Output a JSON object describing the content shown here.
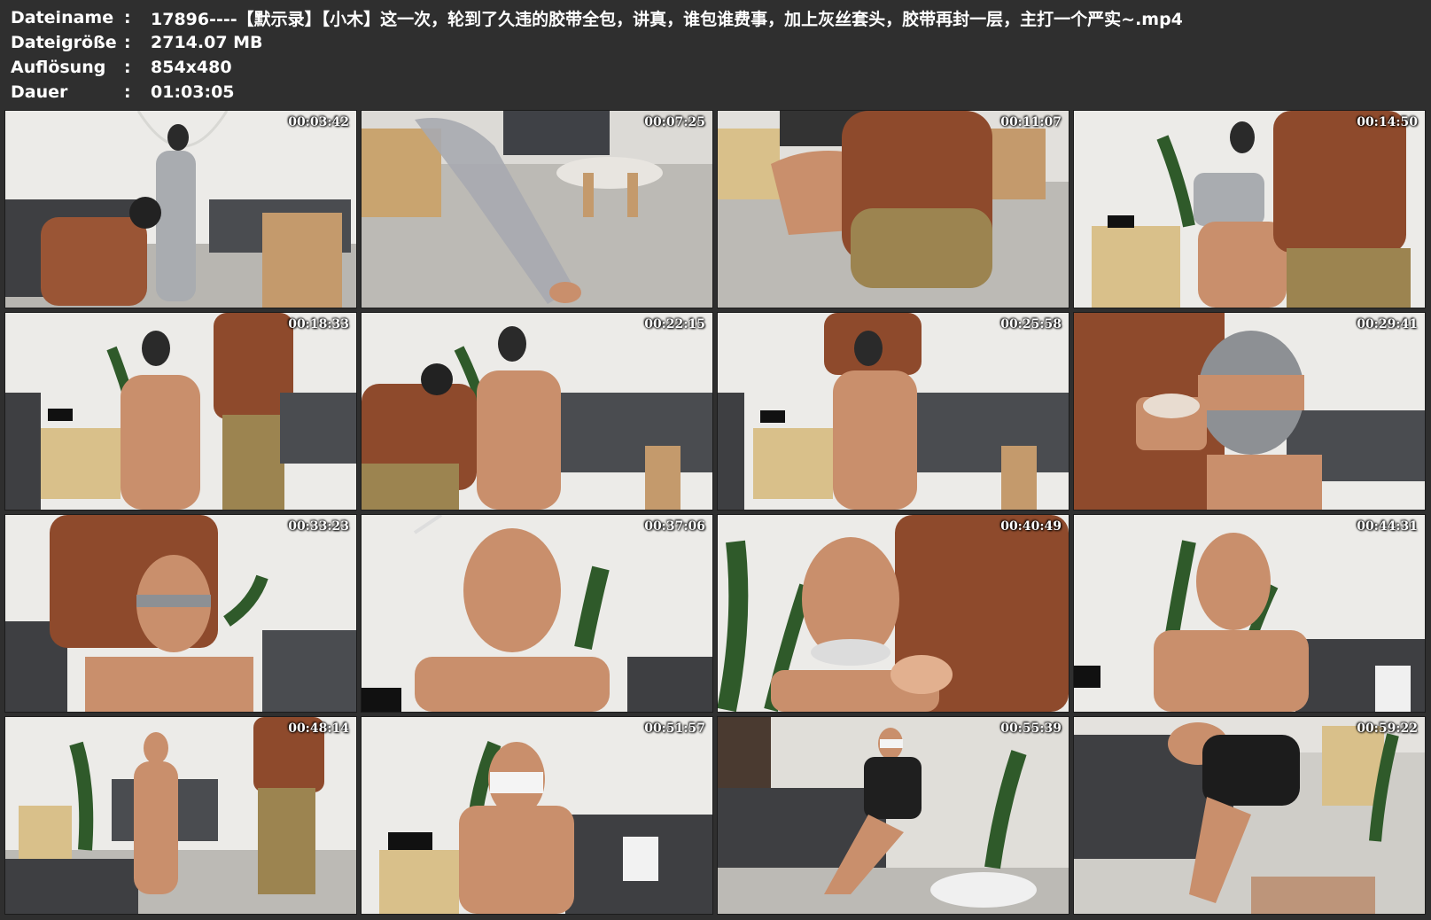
{
  "header": {
    "filename_label": "Dateiname",
    "filename_value": "17896----【默示录】【小木】这一次，轮到了久违的胶带全包，讲真，谁包谁费事，加上灰丝套头，胶带再封一层，主打一个严实~.mp4",
    "size_label": "Dateigröße",
    "size_value": "2714.07 MB",
    "resolution_label": "Auflösung",
    "resolution_value": "854x480",
    "duration_label": "Dauer",
    "duration_value": "01:03:05",
    "separator": ":"
  },
  "thumbnails": [
    {
      "timestamp": "00:03:42"
    },
    {
      "timestamp": "00:07:25"
    },
    {
      "timestamp": "00:11:07"
    },
    {
      "timestamp": "00:14:50"
    },
    {
      "timestamp": "00:18:33"
    },
    {
      "timestamp": "00:22:15"
    },
    {
      "timestamp": "00:25:58"
    },
    {
      "timestamp": "00:29:41"
    },
    {
      "timestamp": "00:33:23"
    },
    {
      "timestamp": "00:37:06"
    },
    {
      "timestamp": "00:40:49"
    },
    {
      "timestamp": "00:44:31"
    },
    {
      "timestamp": "00:48:14"
    },
    {
      "timestamp": "00:51:57"
    },
    {
      "timestamp": "00:55:39"
    },
    {
      "timestamp": "00:59:22"
    }
  ],
  "colors": {
    "background": "#2f2f2f",
    "text": "#ffffff",
    "tape": "#c98f6c",
    "plaid": "#8a4a2a",
    "wall": "#ececea"
  }
}
